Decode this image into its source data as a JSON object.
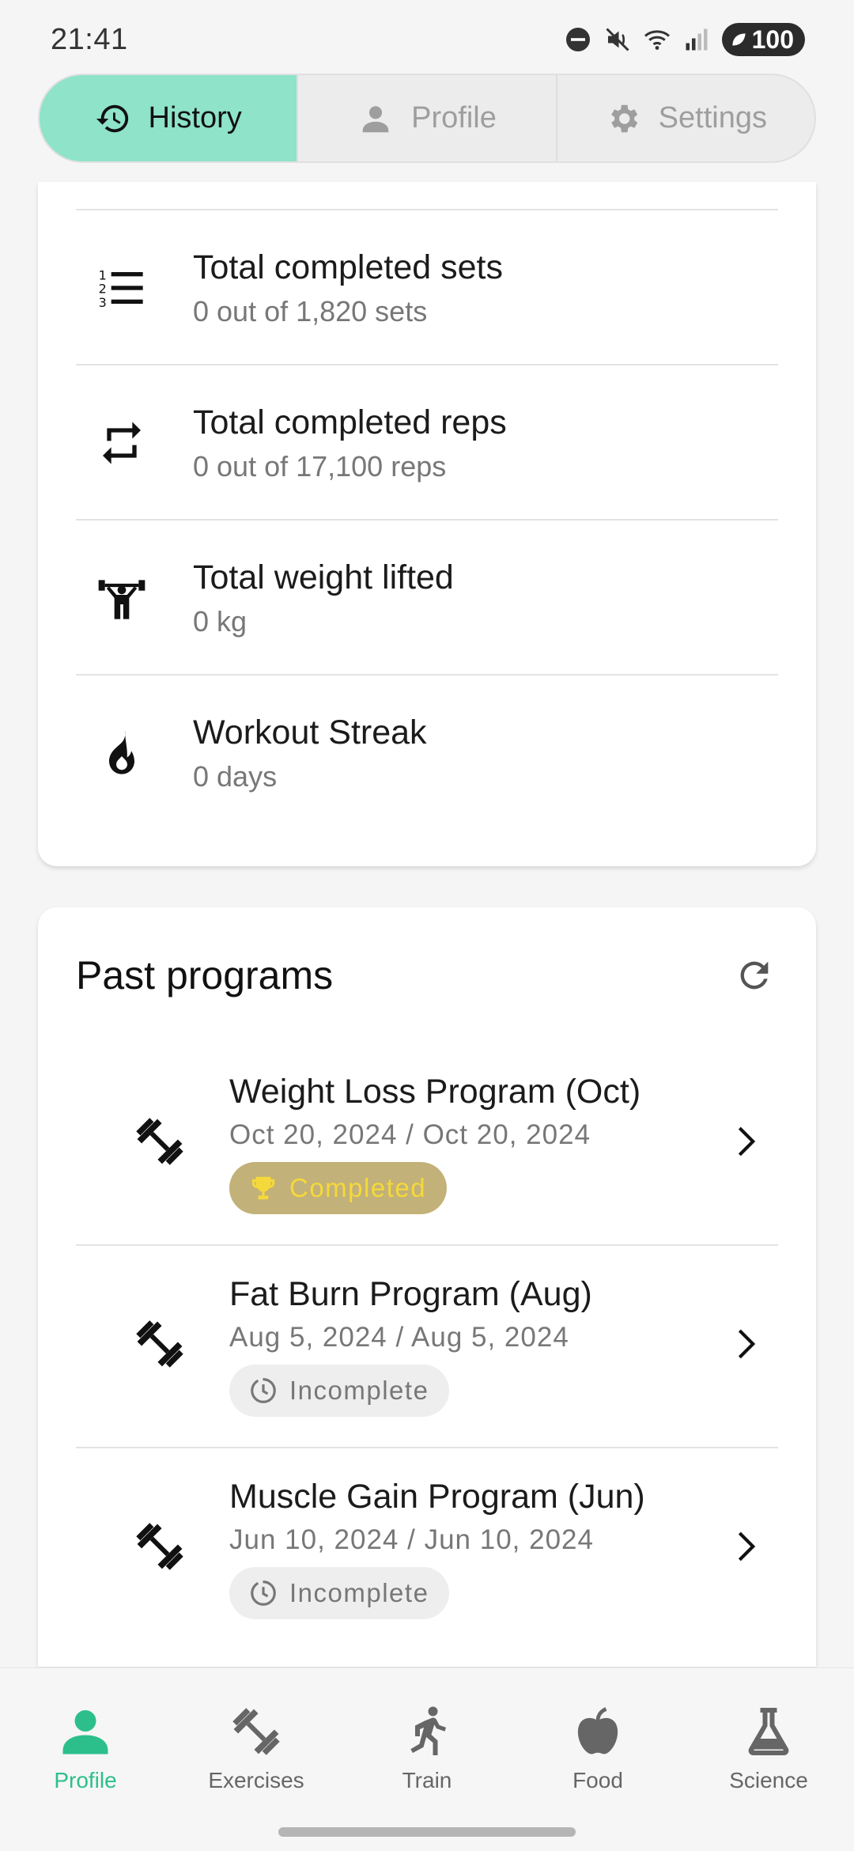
{
  "status": {
    "time": "21:41",
    "battery": "100"
  },
  "tabs": [
    {
      "label": "History",
      "active": true
    },
    {
      "label": "Profile",
      "active": false
    },
    {
      "label": "Settings",
      "active": false
    }
  ],
  "stats": [
    {
      "title": "Total completed sets",
      "subtitle": "0 out of 1,820 sets",
      "icon": "numbered-list-icon"
    },
    {
      "title": "Total completed reps",
      "subtitle": "0 out of 17,100 reps",
      "icon": "repeat-icon"
    },
    {
      "title": "Total weight lifted",
      "subtitle": "0 kg",
      "icon": "weightlifter-icon"
    },
    {
      "title": "Workout Streak",
      "subtitle": "0 days",
      "icon": "flame-icon"
    }
  ],
  "past_programs": {
    "title": "Past programs",
    "items": [
      {
        "title": "Weight Loss Program (Oct)",
        "dates": "Oct 20, 2024 / Oct 20, 2024",
        "status": "Completed"
      },
      {
        "title": "Fat Burn Program (Aug)",
        "dates": "Aug 5, 2024 / Aug 5, 2024",
        "status": "Incomplete"
      },
      {
        "title": "Muscle Gain Program (Jun)",
        "dates": "Jun 10, 2024 / Jun 10, 2024",
        "status": "Incomplete"
      }
    ]
  },
  "bottom_nav": [
    {
      "label": "Profile",
      "active": true
    },
    {
      "label": "Exercises",
      "active": false
    },
    {
      "label": "Train",
      "active": false
    },
    {
      "label": "Food",
      "active": false
    },
    {
      "label": "Science",
      "active": false
    }
  ],
  "colors": {
    "accent": "#2dbf8b",
    "tab_active": "#8ee3c9",
    "badge_completed_bg": "#c2b178",
    "badge_completed_fg": "#f5d93a"
  }
}
